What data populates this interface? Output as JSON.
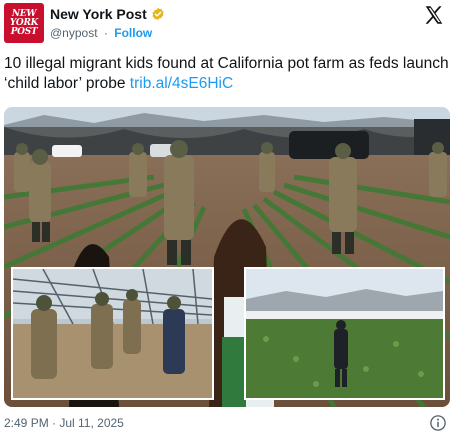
{
  "account": {
    "avatar_lines": [
      "NEW",
      "YORK",
      "POST"
    ],
    "display_name": "New York Post",
    "handle": "@nypost",
    "separator": "·",
    "follow_label": "Follow",
    "verified_color": "#e2b719"
  },
  "tweet": {
    "text": "10 illegal migrant kids found at California pot farm as feds launch ‘child labor’ probe ",
    "link_text": "trib.al/4sE6HiC"
  },
  "media": {
    "description_icons": [
      "soldiers-photo",
      "greenhouse-inset-photo",
      "field-inset-photo"
    ]
  },
  "footer": {
    "timestamp": "2:49 PM · Jul 11, 2025"
  },
  "colors": {
    "link": "#1d9bf0",
    "muted": "#536471",
    "brand_red": "#c8102e"
  }
}
